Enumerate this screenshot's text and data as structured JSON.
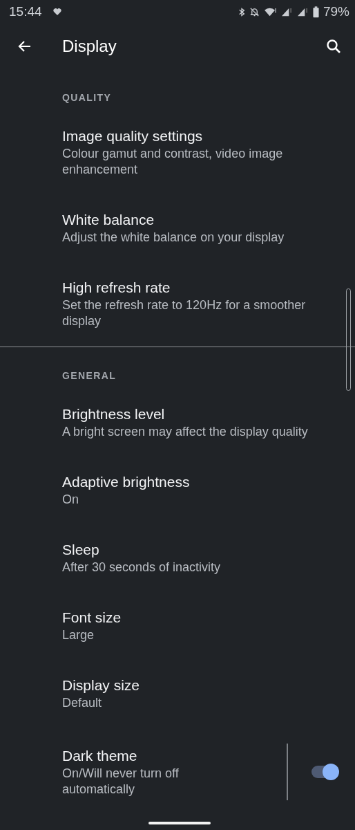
{
  "status_bar": {
    "time": "15:44",
    "battery": "79%"
  },
  "app_bar": {
    "title": "Display"
  },
  "sections": [
    {
      "header": "QUALITY",
      "items": [
        {
          "kind": "text",
          "title": "Image quality settings",
          "summary": "Colour gamut and contrast, video image enhancement"
        },
        {
          "kind": "text",
          "title": "White balance",
          "summary": "Adjust the white balance on your display"
        },
        {
          "kind": "text",
          "title": "High refresh rate",
          "summary": "Set the refresh rate to 120Hz for a smoother display"
        }
      ]
    },
    {
      "header": "GENERAL",
      "items": [
        {
          "kind": "text",
          "title": "Brightness level",
          "summary": "A bright screen may affect the display quality"
        },
        {
          "kind": "text",
          "title": "Adaptive brightness",
          "summary": "On"
        },
        {
          "kind": "text",
          "title": "Sleep",
          "summary": "After 30 seconds of inactivity"
        },
        {
          "kind": "text",
          "title": "Font size",
          "summary": "Large"
        },
        {
          "kind": "text",
          "title": "Display size",
          "summary": "Default"
        },
        {
          "kind": "switch",
          "title": "Dark theme",
          "summary": "On/Will never turn off automatically",
          "checked": true
        }
      ]
    }
  ]
}
